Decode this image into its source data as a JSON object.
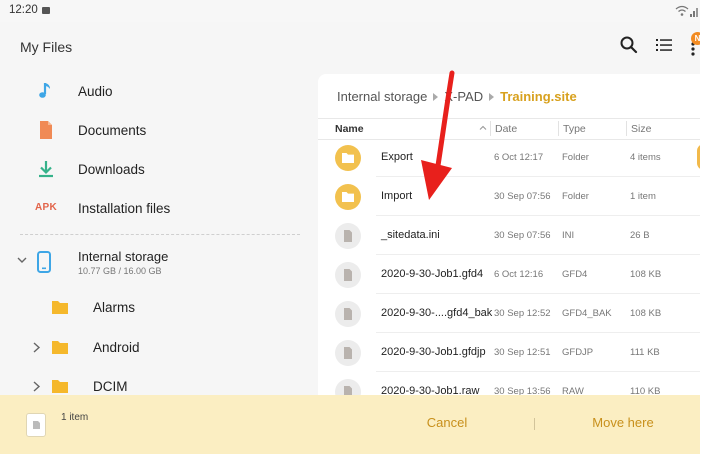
{
  "status_bar": {
    "time": "12:20"
  },
  "app_bar": {
    "title": "My Files",
    "badge": "N"
  },
  "sidebar": {
    "items": [
      {
        "label": "Audio",
        "icon": "music-note-icon"
      },
      {
        "label": "Documents",
        "icon": "document-icon"
      },
      {
        "label": "Downloads",
        "icon": "download-icon"
      },
      {
        "label": "Installation files",
        "icon": "apk-icon",
        "icon_text": "APK"
      }
    ],
    "storage": {
      "label": "Internal storage",
      "sub": "10.77 GB / 16.00 GB"
    },
    "subfolders": [
      {
        "label": "Alarms"
      },
      {
        "label": "Android"
      },
      {
        "label": "DCIM"
      }
    ]
  },
  "panel": {
    "breadcrumb": {
      "root": "Internal storage",
      "mid": "X-PAD",
      "current": "Training.site"
    },
    "columns": {
      "name": "Name",
      "date": "Date",
      "type": "Type",
      "size": "Size"
    },
    "rows": [
      {
        "name": "Export",
        "date": "6 Oct 12:17",
        "type": "Folder",
        "size": "4 items",
        "kind": "folder"
      },
      {
        "name": "Import",
        "date": "30 Sep 07:56",
        "type": "Folder",
        "size": "1 item",
        "kind": "folder"
      },
      {
        "name": "_sitedata.ini",
        "date": "30 Sep 07:56",
        "type": "INI",
        "size": "26 B",
        "kind": "file"
      },
      {
        "name": "2020-9-30-Job1.gfd4",
        "date": "6 Oct 12:16",
        "type": "GFD4",
        "size": "108 KB",
        "kind": "file"
      },
      {
        "name": "2020-9-30-....gfd4_bak",
        "date": "30 Sep 12:52",
        "type": "GFD4_BAK",
        "size": "108 KB",
        "kind": "file"
      },
      {
        "name": "2020-9-30-Job1.gfdjp",
        "date": "30 Sep 12:51",
        "type": "GFDJP",
        "size": "111 KB",
        "kind": "file"
      },
      {
        "name": "2020-9-30-Job1.raw",
        "date": "30 Sep 13:56",
        "type": "RAW",
        "size": "110 KB",
        "kind": "file"
      }
    ]
  },
  "bottom_bar": {
    "count": "1 item",
    "cancel": "Cancel",
    "move_here": "Move here"
  },
  "colors": {
    "accent": "#d8a11e",
    "folder": "#f2c14e",
    "arrow": "#e8201c",
    "bottom": "#fbeec2"
  }
}
